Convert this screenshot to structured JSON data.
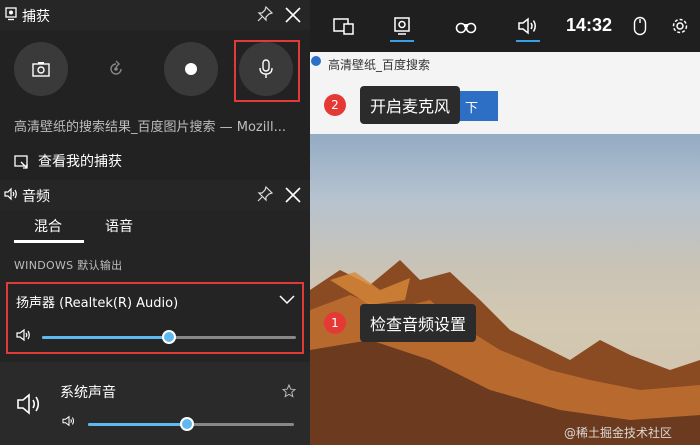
{
  "topbar": {
    "icons": [
      "widget-icon",
      "capture-icon",
      "binoculars-icon",
      "speaker-icon",
      "mouse-icon",
      "gear-icon"
    ],
    "clock": "14:32"
  },
  "browser": {
    "tab_title": "高清壁纸_百度搜索",
    "button_label": "下"
  },
  "capture": {
    "title": "捕获",
    "buttons": [
      "screenshot",
      "record-last",
      "record",
      "microphone"
    ],
    "source": "高清壁纸的搜索结果_百度图片搜索 — Mozill...",
    "see_captures": "查看我的捕获"
  },
  "audio": {
    "title": "音频",
    "tabs": [
      "混合",
      "语音"
    ],
    "active_tab": 0,
    "section_label": "WINDOWS 默认输出",
    "device": "扬声器 (Realtek(R) Audio)",
    "device_volume": 0.5,
    "system_label": "系统声音",
    "system_volume": 0.48
  },
  "callouts": [
    {
      "number": "2",
      "text": "开启麦克风"
    },
    {
      "number": "1",
      "text": "检查音频设置"
    }
  ],
  "watermark": "@稀土掘金技术社区",
  "colors": {
    "accent": "#5fb8f0",
    "highlight": "#e03b3b",
    "badge": "#e53935"
  }
}
